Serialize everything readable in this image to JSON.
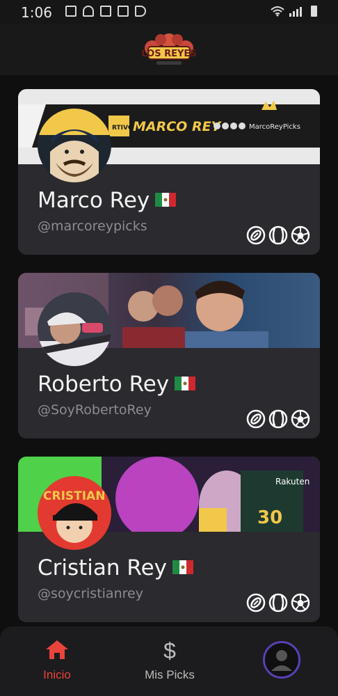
{
  "status_bar": {
    "time": "1:06"
  },
  "app": {
    "logo_text": "LOS REYES"
  },
  "cards": [
    {
      "name": "Marco Rey",
      "handle": "@marcoreypicks",
      "banner_title": "MARCO REY",
      "banner_handle": "MarcoReyPicks",
      "banner_tag": "RTIVO"
    },
    {
      "name": "Roberto Rey",
      "handle": "@SoyRobertoRey"
    },
    {
      "name": "Cristian Rey",
      "handle": "@soycristianrey",
      "banner_text": "CRISTIAN REY"
    }
  ],
  "nav": {
    "home_label": "Inicio",
    "picks_label": "Mis Picks",
    "picks_icon": "$",
    "active_color": "#e8443b",
    "accent_color": "#5a3fb8"
  }
}
